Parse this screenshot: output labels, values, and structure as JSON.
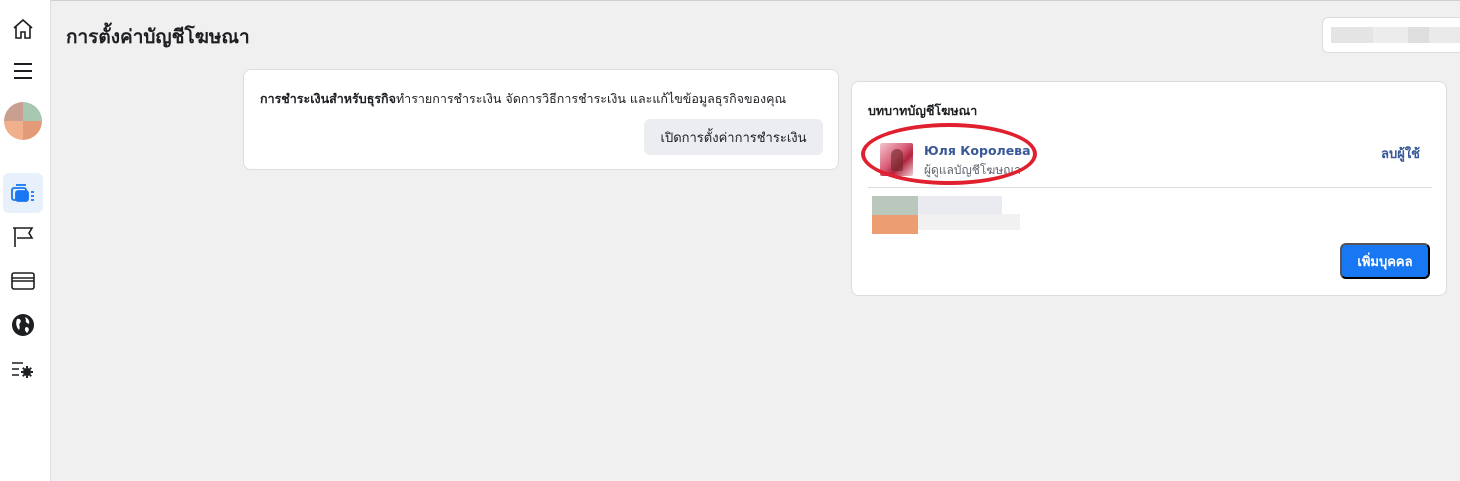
{
  "header": {
    "title": "การตั้งค่าบัญชีโฆษณา"
  },
  "rail": {
    "items": [
      {
        "icon": "home-icon"
      },
      {
        "icon": "menu-icon"
      },
      {
        "icon": "avatar"
      },
      {
        "icon": "ad-accounts-icon",
        "active": true
      },
      {
        "icon": "flag-icon"
      },
      {
        "icon": "credit-card-icon"
      },
      {
        "icon": "globe-icon"
      },
      {
        "icon": "settings-list-icon"
      }
    ]
  },
  "payment_card": {
    "description_bold": "การชำระเงินสำหรับธุรกิจ",
    "description_rest": "ทำรายการชำระเงิน จัดการวิธีการชำระเงิน และแก้ไขข้อมูลธุรกิจของคุณ",
    "button_label": "เปิดการตั้งค่าการชำระเงิน"
  },
  "roles_card": {
    "title": "บทบาทบัญชีโฆษณา",
    "user": {
      "name": "Юля Королева",
      "role": "ผู้ดูแลบัญชีโฆษณา",
      "remove_label": "ลบผู้ใช้"
    },
    "add_button_label": "เพิ่มบุคคล"
  },
  "colors": {
    "accent": "#1877f2",
    "link": "#385898",
    "highlight": "#e0202e"
  }
}
